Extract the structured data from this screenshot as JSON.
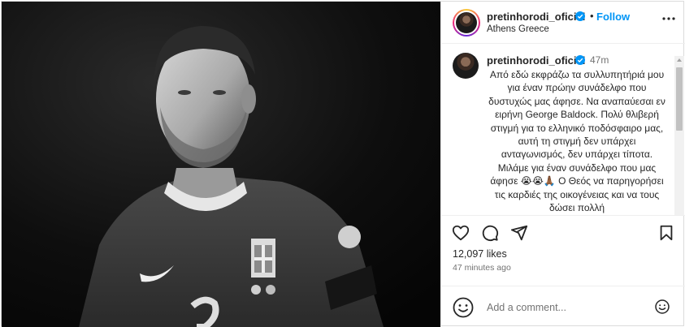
{
  "post": {
    "author": "pretinhorodi_oficial",
    "follow_label": "Follow",
    "separator": "•",
    "location": "Athens Greece",
    "photo_alt": "Black and white photo of a footballer in national team jersey"
  },
  "caption": {
    "author": "pretinhorodi_oficial",
    "time": "47m",
    "text": "Από εδώ εκφράζω τα συλλυπητήριά μου για έναν πρώην συνάδελφο που δυστυχώς μας άφησε. Να αναπαύεσαι εν ειρήνη George Baldock. Πολύ θλιβερή στιγμή για το ελληνικό ποδόσφαιρο μας, αυτή τη στιγμή δεν υπάρχει ανταγωνισμός, δεν υπάρχει τίποτα. Μιλάμε για έναν συνάδελφο που μας άφησε 😭😭🙏🏾 Ο Θεός να παρηγορήσει τις καρδιές της οικογένειας και να τους δώσει πολλή"
  },
  "stats": {
    "likes": "12,097 likes",
    "posted": "47 minutes ago"
  },
  "comment": {
    "placeholder": "Add a comment..."
  },
  "icons": [
    "more-icon",
    "verified-icon",
    "heart-icon",
    "comment-icon",
    "share-icon",
    "bookmark-icon",
    "emoji-icon"
  ],
  "colors": {
    "accent": "#0095f6",
    "verified": "#0095f6",
    "text": "#262626",
    "muted": "#737373"
  }
}
